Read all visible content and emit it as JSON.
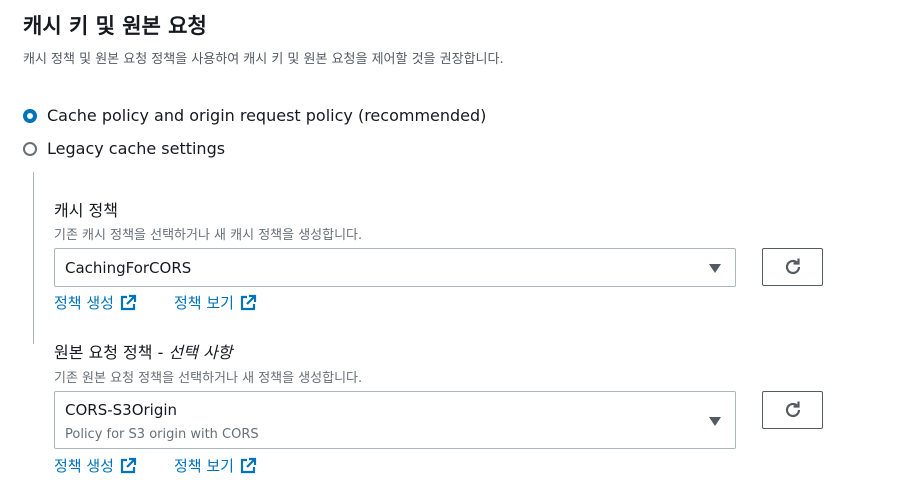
{
  "section": {
    "title": "캐시 키 및 원본 요청",
    "description": "캐시 정책 및 원본 요청 정책을 사용하여 캐시 키 및 원본 요청을 제어할 것을 권장합니다."
  },
  "options": [
    {
      "label": "Cache policy and origin request policy (recommended)",
      "selected": true
    },
    {
      "label": "Legacy cache settings",
      "selected": false
    }
  ],
  "cache_policy": {
    "label": "캐시 정책",
    "description": "기존 캐시 정책을 선택하거나 새 캐시 정책을 생성합니다.",
    "selected_value": "CachingForCORS",
    "create_link": "정책 생성",
    "view_link": "정책 보기"
  },
  "origin_request_policy": {
    "label": "원본 요청 정책 - ",
    "label_optional": "선택 사항",
    "description": "기존 원본 요청 정책을 선택하거나 새 정책을 생성합니다.",
    "selected_value": "CORS-S3Origin",
    "selected_description": "Policy for S3 origin with CORS",
    "create_link": "정책 생성",
    "view_link": "정책 보기"
  },
  "icons": {
    "refresh": "refresh-icon",
    "external": "external-link-icon",
    "dropdown": "caret-down-icon"
  },
  "colors": {
    "accent": "#0073bb",
    "text": "#16191f",
    "muted": "#687078"
  }
}
